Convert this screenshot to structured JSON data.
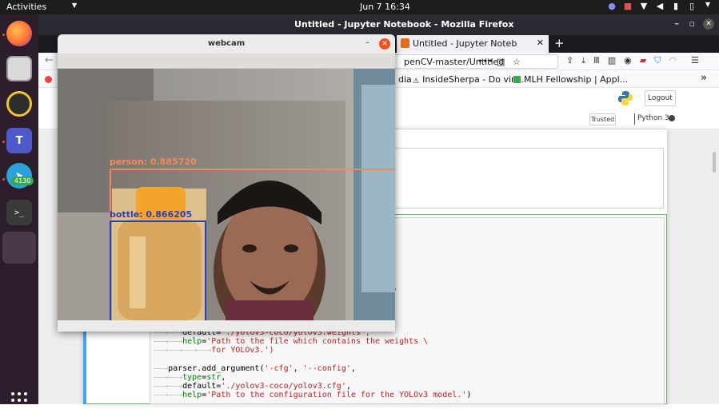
{
  "topbar": {
    "activities": "Activities",
    "clock": "Jun 7  16:34"
  },
  "dock": {
    "telegram_badge": "4130",
    "items": [
      "firefox",
      "files",
      "rhythmbox",
      "teams",
      "telegram",
      "terminal",
      "app-window"
    ]
  },
  "firefox": {
    "window_title": "Untitled - Jupyter Notebook - Mozilla Firefox",
    "tab_title": "Untitled - Jupyter Noteb",
    "url": "penCV-master/Untitled",
    "bookmarks": [
      {
        "label": "dia"
      },
      {
        "label": "InsideSherpa - Do virt..."
      },
      {
        "label": "MLH Fellowship | Appl..."
      }
    ]
  },
  "jupyter": {
    "logout": "Logout",
    "trusted": "Trusted",
    "kernel": "Python 3",
    "code_fragment_right": "d \\",
    "code": {
      "l1_key": "default",
      "l1_val": "'./yolov3-coco/yolov3.weights',",
      "l2_key": "help",
      "l2_val": "'Path to the file which contains the weights \\",
      "l3_val": "for YOLOv3.')",
      "l4_call": "parser.add_argument(",
      "l4_a1": "'-cfg'",
      "l4_a2": "'--config'",
      "l5_key": "type",
      "l5_val": "str",
      "l6_key": "default",
      "l6_val": "'./yolov3-coco/yolov3.cfg'",
      "l7_key": "help",
      "l7_val": "'Path to the configuration file for the YOLOv3 model.'"
    }
  },
  "webcam": {
    "title": "webcam",
    "detections": [
      {
        "label": "person:  0.885720",
        "color": "#f08a5d"
      },
      {
        "label": "bottle:  0.866205",
        "color": "#2a3fb8"
      }
    ]
  },
  "colors": {
    "ubuntu_orange": "#e95420",
    "dock_bg": "#2c1d2a",
    "topbar_bg": "#1d1d1d"
  }
}
